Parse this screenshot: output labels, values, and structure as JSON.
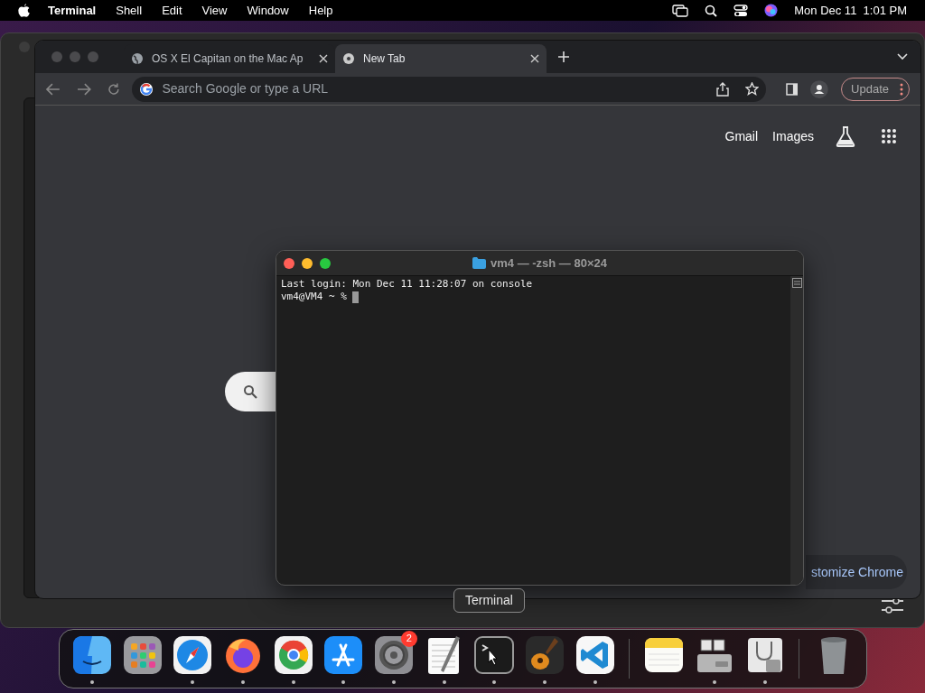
{
  "menubar": {
    "app": "Terminal",
    "menus": [
      "Shell",
      "Edit",
      "View",
      "Window",
      "Help"
    ],
    "clock": "Mon Dec 11  1:01 PM"
  },
  "browser": {
    "tabs": [
      {
        "title": "OS X El Capitan on the Mac Ap",
        "selected": false
      },
      {
        "title": "New Tab",
        "selected": true
      }
    ],
    "address_placeholder": "Search Google or type a URL",
    "update": "Update",
    "links": [
      "Gmail",
      "Images"
    ],
    "customize": "stomize Chrome"
  },
  "terminal": {
    "title": "vm4 — -zsh — 80×24",
    "lines": [
      "Last login: Mon Dec 11 11:28:07 on console",
      "vm4@VM4 ~ % "
    ]
  },
  "dock": {
    "tooltip": "Terminal",
    "sections": [
      [
        {
          "kind": "finder",
          "running": true
        },
        {
          "kind": "launchpad",
          "running": false
        },
        {
          "kind": "safari",
          "running": true
        },
        {
          "kind": "firefox",
          "running": true
        },
        {
          "kind": "chrome",
          "running": true
        },
        {
          "kind": "appstore",
          "running": true
        },
        {
          "kind": "settings",
          "running": true,
          "badge": "2"
        },
        {
          "kind": "textedit",
          "running": true
        },
        {
          "kind": "terminal",
          "running": true
        },
        {
          "kind": "garageband",
          "running": true
        },
        {
          "kind": "vscode",
          "running": true
        }
      ],
      [
        {
          "kind": "notes",
          "running": false
        },
        {
          "kind": "bootcamp",
          "running": true
        },
        {
          "kind": "diskutility",
          "running": true
        }
      ],
      [
        {
          "kind": "trash",
          "running": false
        }
      ]
    ]
  }
}
